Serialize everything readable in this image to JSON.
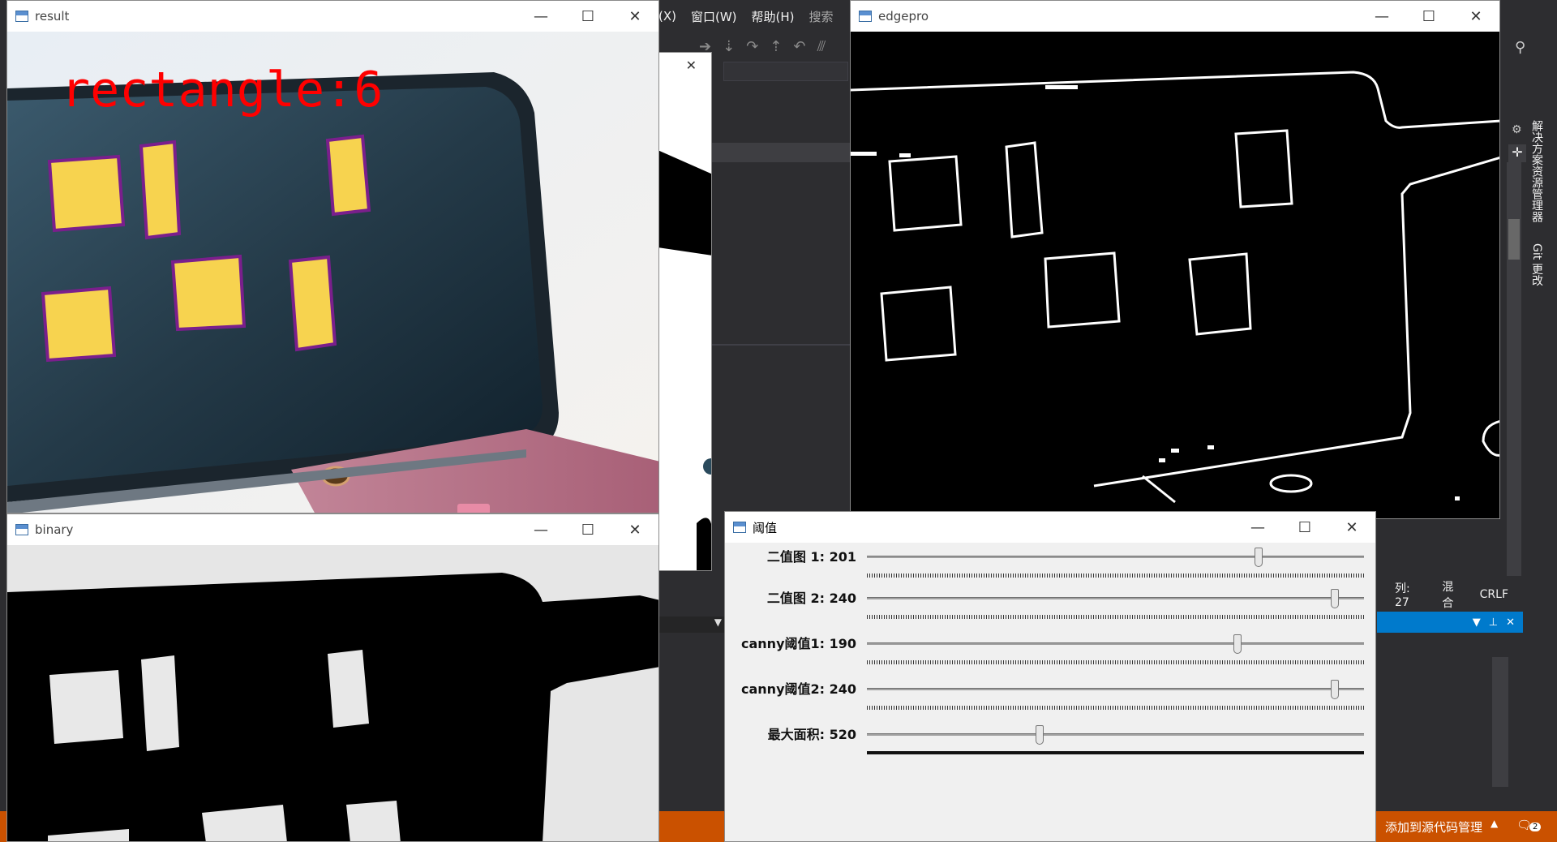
{
  "ide": {
    "menu": [
      "窗口(W)",
      "帮助(H)",
      "搜索"
    ],
    "menu_partial": "(X)",
    "side_panel_1": "解决方案资源管理器",
    "side_panel_2": "Git 更改",
    "status": {
      "col": "列: 27",
      "mode": "混合",
      "eol": "CRLF"
    },
    "source_control": "添加到源代码管理",
    "notifications": "2"
  },
  "windows": {
    "result": {
      "title": "result",
      "overlay_text": "rectangle:6"
    },
    "binary": {
      "title": "binary"
    },
    "edgepro": {
      "title": "edgepro"
    },
    "threshold": {
      "title": "阈值",
      "sliders": [
        {
          "label": "二值图 1: 201",
          "value": 201,
          "max": 255
        },
        {
          "label": "二值图 2: 240",
          "value": 240,
          "max": 255
        },
        {
          "label": "canny阈值1: 190",
          "value": 190,
          "max": 255
        },
        {
          "label": "canny阈值2: 240",
          "value": 240,
          "max": 255
        },
        {
          "label": "最大面积: 520",
          "value": 520,
          "max": 1500
        }
      ]
    }
  },
  "colors": {
    "accent": "#007acc",
    "status_orange": "#ca5100",
    "rect_fill": "#f7d34f",
    "rect_border": "#7a1f8c",
    "overlay_text": "#ff0000"
  }
}
